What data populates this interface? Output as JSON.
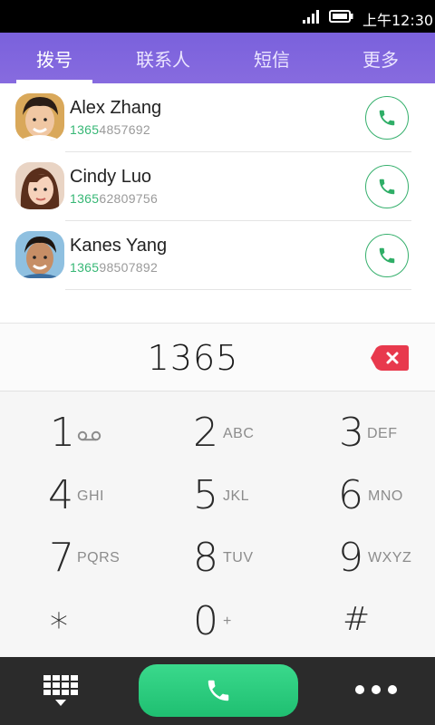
{
  "status_bar": {
    "time": "上午12:30"
  },
  "tabs": [
    {
      "label": "拨号",
      "active": true
    },
    {
      "label": "联系人",
      "active": false
    },
    {
      "label": "短信",
      "active": false
    },
    {
      "label": "更多",
      "active": false
    }
  ],
  "contacts": [
    {
      "name": "Alex Zhang",
      "number_match": "1365",
      "number_rest": "4857692"
    },
    {
      "name": "Cindy Luo",
      "number_match": "1365",
      "number_rest": "62809756"
    },
    {
      "name": "Kanes Yang",
      "number_match": "1365",
      "number_rest": "98507892"
    }
  ],
  "dialer": {
    "number": "1365"
  },
  "keys": [
    {
      "digit": "1",
      "letters": ""
    },
    {
      "digit": "2",
      "letters": "ABC"
    },
    {
      "digit": "3",
      "letters": "DEF"
    },
    {
      "digit": "4",
      "letters": "GHI"
    },
    {
      "digit": "5",
      "letters": "JKL"
    },
    {
      "digit": "6",
      "letters": "MNO"
    },
    {
      "digit": "7",
      "letters": "PQRS"
    },
    {
      "digit": "8",
      "letters": "TUV"
    },
    {
      "digit": "9",
      "letters": "WXYZ"
    },
    {
      "digit": "*",
      "letters": ""
    },
    {
      "digit": "0",
      "letters": "+"
    },
    {
      "digit": "#",
      "letters": ""
    }
  ],
  "icons": {
    "signal": "signal-icon",
    "battery": "battery-icon",
    "call": "phone-icon",
    "backspace": "backspace-icon",
    "voicemail": "voicemail-icon",
    "keypad": "keypad-icon",
    "more": "more-icon"
  },
  "colors": {
    "accent": "#7b62dc",
    "call_green": "#2bcc7e",
    "match_green": "#36b775",
    "backspace_red": "#e8394d"
  }
}
